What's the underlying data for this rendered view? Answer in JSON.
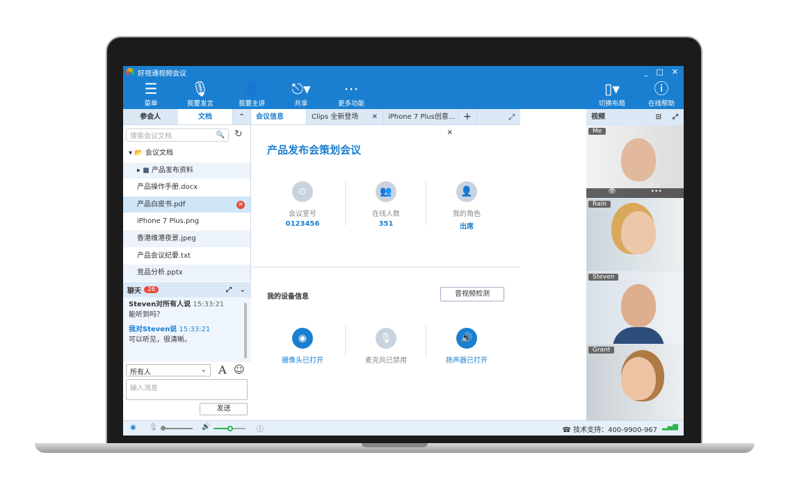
{
  "app": {
    "title": "好视通视频会议",
    "window_controls": [
      "_",
      "□",
      "✕"
    ]
  },
  "toolbar": {
    "items": [
      {
        "label": "菜单",
        "icon": "menu-icon"
      },
      {
        "label": "我要发言",
        "icon": "microphone-icon"
      },
      {
        "label": "我要主讲",
        "icon": "presenter-icon"
      },
      {
        "label": "共享",
        "icon": "share-icon"
      },
      {
        "label": "更多功能",
        "icon": "more-icon"
      },
      {
        "label": "切换布局",
        "icon": "layout-icon"
      },
      {
        "label": "在线帮助",
        "icon": "help-icon"
      }
    ]
  },
  "left": {
    "tabs": [
      "参会人",
      "文档"
    ],
    "search_placeholder": "搜索会议文档",
    "root_folder": "会议文档",
    "subfolder": "产品发布资料",
    "files": [
      "产品操作手册.docx",
      "产品白皮书.pdf",
      "iPhone 7 Plus.png",
      "香港维港夜景.jpeg",
      "产品会议纪要.txt",
      "竞品分析.pptx"
    ]
  },
  "chat": {
    "title": "聊天",
    "unread": "26",
    "messages": [
      {
        "sender": "Steven对所有人说",
        "time": "15:33:21",
        "text": "能听到吗？"
      },
      {
        "sender": "我对Steven说",
        "time": "15:33:21",
        "text": "可以听见，很清晰。"
      }
    ],
    "recipient": "所有人",
    "input_placeholder": "输入消息",
    "send": "发送"
  },
  "center": {
    "tabs": [
      "会议信息",
      "Clips 全新登场",
      "iPhone 7 Plus创意..."
    ],
    "title": "产品发布会策划会议",
    "stats": [
      {
        "label": "会议室号",
        "value": "0123456"
      },
      {
        "label": "在线人数",
        "value": "351"
      },
      {
        "label": "我的角色",
        "value": "出席"
      }
    ],
    "device_title": "我的设备信息",
    "check_button": "音视频检测",
    "devices": [
      {
        "label": "摄像头已打开",
        "state": "on"
      },
      {
        "label": "麦克风已禁用",
        "state": "off"
      },
      {
        "label": "扬声器已打开",
        "state": "on"
      }
    ]
  },
  "video": {
    "title": "视频",
    "participants": [
      "Me",
      "Rain",
      "Steven",
      "Grant"
    ]
  },
  "status": {
    "support": "技术支持：400-9900-967"
  },
  "colors": {
    "primary": "#1a7fd0",
    "danger": "#e84c3d",
    "green": "#2db34a"
  }
}
